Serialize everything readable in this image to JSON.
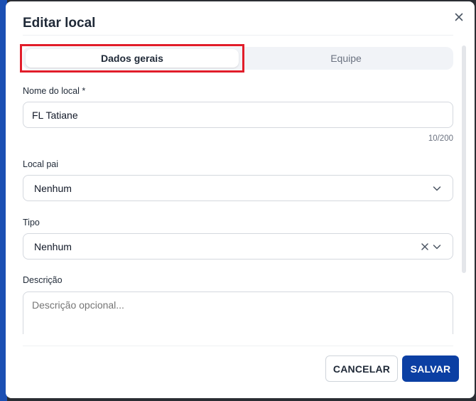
{
  "dialog": {
    "title": "Editar local",
    "close_icon": "close-icon"
  },
  "tabs": [
    {
      "label": "Dados gerais",
      "active": true
    },
    {
      "label": "Equipe",
      "active": false
    }
  ],
  "form": {
    "name": {
      "label": "Nome do local *",
      "value": "FL Tatiane",
      "counter": "10/200"
    },
    "parent": {
      "label": "Local pai",
      "value": "Nenhum",
      "icon": "chevron-down-icon"
    },
    "type": {
      "label": "Tipo",
      "value": "Nenhum",
      "clear_icon": "clear-icon",
      "icon": "chevron-down-icon"
    },
    "description": {
      "label": "Descrição",
      "placeholder": "Descrição opcional..."
    }
  },
  "footer": {
    "cancel_label": "CANCELAR",
    "save_label": "SALVAR"
  },
  "colors": {
    "primary": "#0b3fa3",
    "highlight": "#e11d2a",
    "accent_strip": "#1b4fb3"
  }
}
